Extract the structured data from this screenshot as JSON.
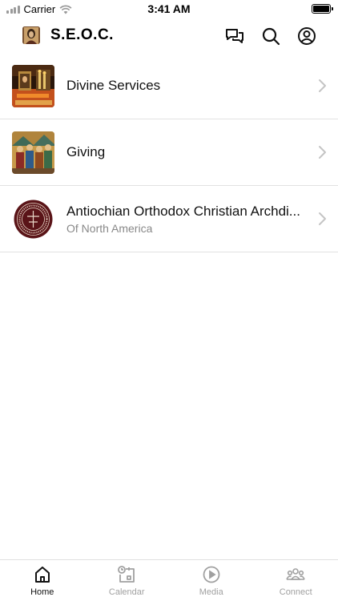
{
  "status_bar": {
    "carrier": "Carrier",
    "time": "3:41 AM"
  },
  "header": {
    "title": "S.E.O.C.",
    "icons": [
      "chat-icon",
      "search-icon",
      "profile-icon"
    ]
  },
  "list": {
    "items": [
      {
        "title": "Divine Services",
        "subtitle": "",
        "thumb": "candles-icon-image"
      },
      {
        "title": "Giving",
        "subtitle": "",
        "thumb": "icon-painting-image"
      },
      {
        "title": "Antiochian Orthodox Christian Archdi...",
        "subtitle": "Of North America",
        "thumb": "archdiocese-seal-image"
      }
    ]
  },
  "tabs": [
    {
      "label": "Home",
      "icon": "home-icon",
      "active": true
    },
    {
      "label": "Calendar",
      "icon": "calendar-icon",
      "active": false
    },
    {
      "label": "Media",
      "icon": "play-icon",
      "active": false
    },
    {
      "label": "Connect",
      "icon": "people-icon",
      "active": false
    }
  ],
  "colors": {
    "active_tab": "#111111",
    "inactive_tab": "#a0a0a0",
    "divider": "#e2e2e2",
    "subtitle": "#888888"
  }
}
